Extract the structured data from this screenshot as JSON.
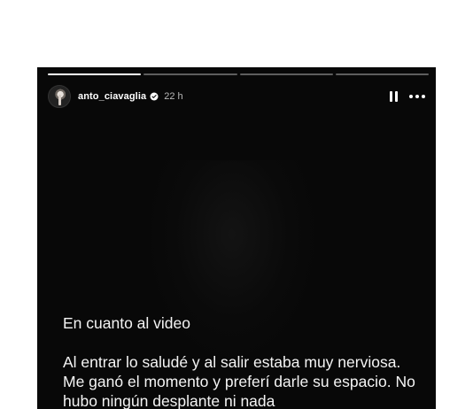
{
  "story": {
    "progress": [
      1,
      0,
      0,
      0
    ],
    "user": {
      "username": "anto_ciavaglia",
      "verified": true,
      "time": "22 h",
      "avatar": "avatar"
    },
    "controls": {
      "pause_icon": "pause-icon",
      "more_icon": "more-options-icon"
    },
    "caption": {
      "title": "En cuanto al video",
      "body": "Al entrar lo saludé y al salir estaba muy nerviosa. Me ganó el momento y preferí darle su espacio. No hubo ningún desplante ni nada"
    }
  },
  "colors": {
    "story_background": "#080808",
    "text": "#f4f4f4",
    "verified_badge": "#ffffff"
  }
}
